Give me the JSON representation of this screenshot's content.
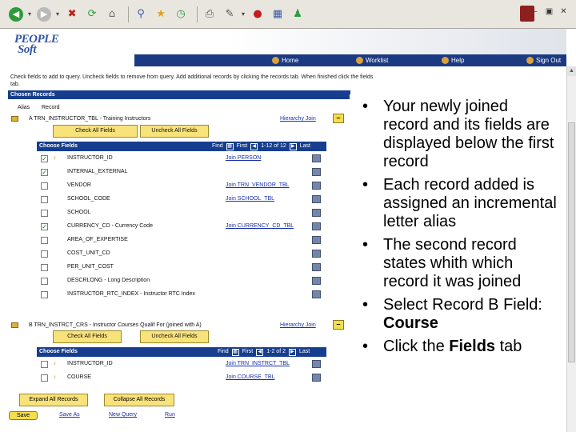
{
  "banner": {
    "logo_line1": "PEOPLE",
    "logo_line2": "Soft",
    "nav": {
      "home": "Home",
      "worklist": "Worklist",
      "help": "Help",
      "signout": "Sign Out"
    }
  },
  "page": {
    "intro": "Check fields to add to query. Uncheck fields to remove from query. Add additional records by clicking the records tab. When finished click the fields tab.",
    "section_title": "Chosen Records",
    "col_alias": "Alias",
    "col_record": "Record"
  },
  "record_a": {
    "line": "A    TRN_INSTRUCTOR_TBL - Training Instructors",
    "hierarchy": "Hierarchy Join",
    "check_all": "Check All Fields",
    "uncheck_all": "Uncheck All Fields",
    "grid_title": "Choose Fields",
    "grid_nav": {
      "find": "Find",
      "first": "First",
      "range": "1-12 of 12",
      "last": "Last"
    },
    "fields": [
      {
        "checked": true,
        "key": true,
        "name": "INSTRUCTOR_ID",
        "join": "Join PERSON"
      },
      {
        "checked": true,
        "key": false,
        "name": "INTERNAL_EXTERNAL",
        "join": ""
      },
      {
        "checked": false,
        "key": false,
        "name": "VENDOR",
        "join": "Join TRN_VENDOR_TBL"
      },
      {
        "checked": false,
        "key": false,
        "name": "SCHOOL_CODE",
        "join": "Join SCHOOL_TBL"
      },
      {
        "checked": false,
        "key": false,
        "name": "SCHOOL",
        "join": ""
      },
      {
        "checked": true,
        "key": false,
        "name": "CURRENCY_CD - Currency Code",
        "join": "Join CURRENCY_CD_TBL"
      },
      {
        "checked": false,
        "key": false,
        "name": "AREA_OF_EXPERTISE",
        "join": ""
      },
      {
        "checked": false,
        "key": false,
        "name": "COST_UNIT_CD",
        "join": ""
      },
      {
        "checked": false,
        "key": false,
        "name": "PER_UNIT_COST",
        "join": ""
      },
      {
        "checked": false,
        "key": false,
        "name": "DESCRLONG - Long Description",
        "join": ""
      },
      {
        "checked": false,
        "key": false,
        "name": "INSTRUCTOR_RTC_INDEX - Instructor RTC Index",
        "join": ""
      }
    ]
  },
  "record_b": {
    "line": "B    TRN_INSTRCT_CRS - Instructor Courses Qualif For (joined with A)",
    "hierarchy": "Hierarchy Join",
    "check_all": "Check All Fields",
    "uncheck_all": "Uncheck All Fields",
    "grid_title": "Choose Fields",
    "grid_nav": {
      "find": "Find",
      "first": "First",
      "range": "1-2 of 2",
      "last": "Last"
    },
    "fields": [
      {
        "checked": false,
        "key": true,
        "name": "INSTRUCTOR_ID",
        "join": "Join TRN_INSTRCT_TBL"
      },
      {
        "checked": false,
        "key": true,
        "name": "COURSE",
        "join": "Join COURSE_TBL"
      }
    ]
  },
  "footer": {
    "expand_all": "Expand All Records",
    "collapse_all": "Collapse All Records",
    "save": "Save",
    "save_as": "Save As",
    "new_query": "New Query",
    "run": "Run"
  },
  "bullets": {
    "b1": "Your newly joined record and its fields are displayed below the first record",
    "b2": "Each record added is assigned an incremental letter alias",
    "b3": "The second record states whith which record it was joined",
    "b4_pre": "Select Record B Field: ",
    "b4_bold": "Course",
    "b5_pre": "Click the ",
    "b5_bold": "Fields",
    "b5_post": " tab"
  },
  "icons": [
    "back-icon",
    "forward-icon",
    "stop-icon",
    "refresh-icon",
    "home-icon",
    "search-icon",
    "favorites-icon",
    "history-icon",
    "print-icon",
    "edit-icon",
    "messenger-icon"
  ]
}
